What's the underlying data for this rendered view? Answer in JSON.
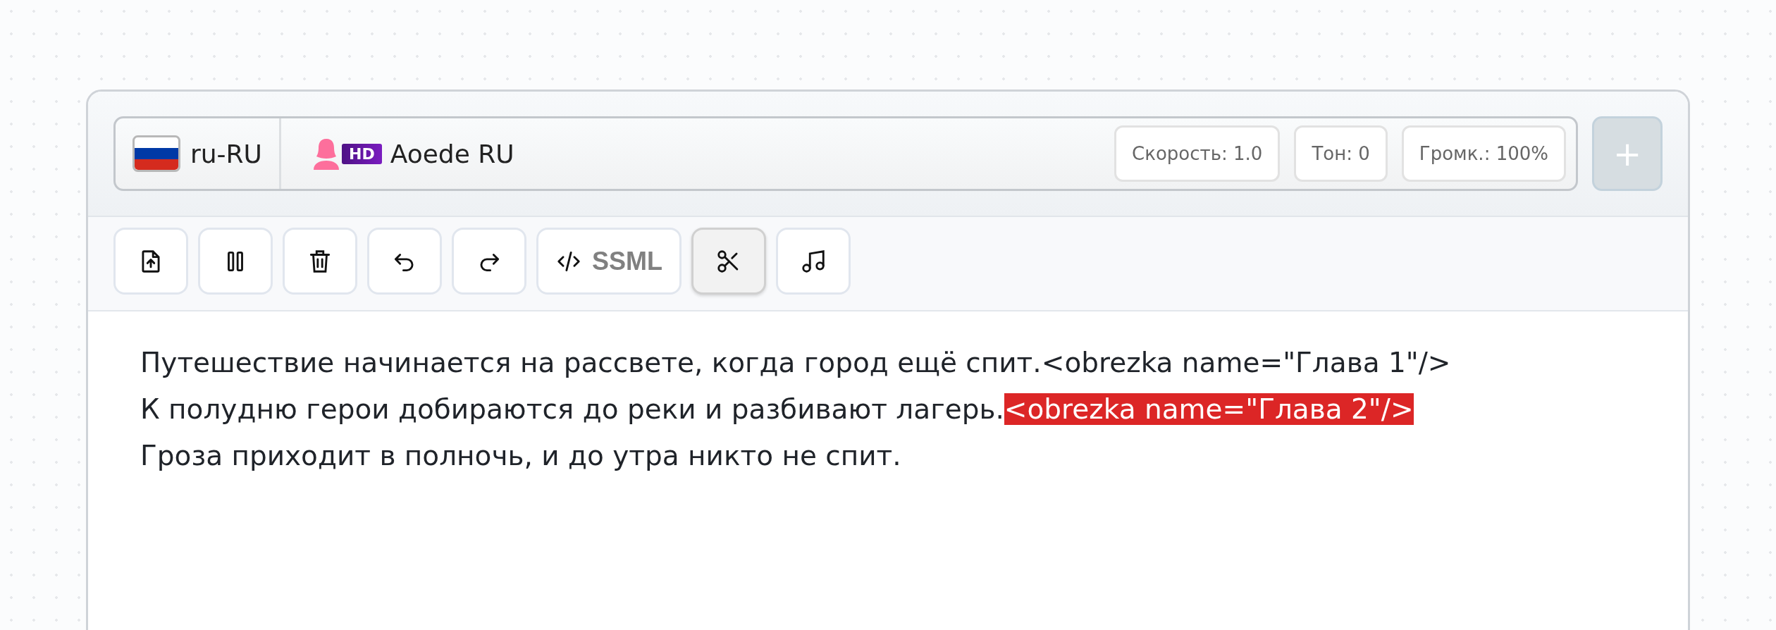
{
  "voice_bar": {
    "language": "ru-RU",
    "voice": {
      "badge": "HD",
      "name": "Aoede RU"
    },
    "settings": [
      "Скорость: 1.0",
      "Тон: 0",
      "Громк.: 100%"
    ],
    "add_button": {
      "label": "+",
      "disabled": true
    }
  },
  "toolbar": [
    {
      "kind": "upload",
      "active": false
    },
    {
      "kind": "pause",
      "active": false
    },
    {
      "kind": "delete",
      "active": false
    },
    {
      "kind": "undo",
      "active": false
    },
    {
      "kind": "redo",
      "active": false
    },
    {
      "kind": "ssml",
      "label": "SSML",
      "active": false
    },
    {
      "kind": "cut",
      "active": true
    },
    {
      "kind": "music",
      "active": false
    }
  ],
  "editor": {
    "lines": [
      [
        {
          "text": "Путешествие начинается на рассвете, когда город ещё спит.<obrezka name=\"Глава 1\"/>",
          "highlighted": false
        }
      ],
      [
        {
          "text": "К полудню герои добираются до реки и разбивают лагерь.",
          "highlighted": false
        },
        {
          "text": "<obrezka name=\"Глава 2\"/>",
          "highlighted": true
        }
      ],
      [
        {
          "text": "Гроза приходит в полночь, и до утра никто не спит.",
          "highlighted": false
        }
      ]
    ]
  }
}
